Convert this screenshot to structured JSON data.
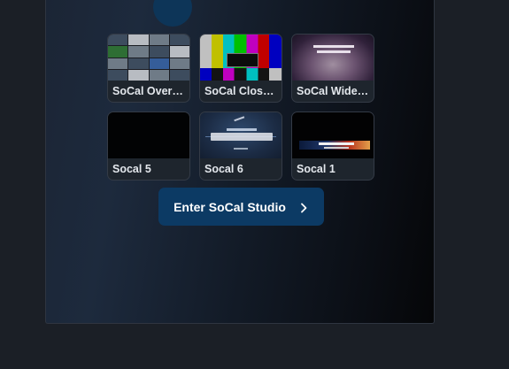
{
  "studios": [
    {
      "label": "SoCal Overh...",
      "thumb": "multi-camera-grid"
    },
    {
      "label": "SoCal Close ...",
      "thumb": "color-bars"
    },
    {
      "label": "SoCal Wide ...",
      "thumb": "wide-stage"
    },
    {
      "label": "Socal 5",
      "thumb": "no-signal-black"
    },
    {
      "label": "Socal 6",
      "thumb": "be-right-back"
    },
    {
      "label": "Socal 1",
      "thumb": "lower-third-graphic"
    }
  ],
  "enter_button": {
    "label": "Enter SoCal Studio",
    "icon": "chevron-right-icon"
  },
  "colors": {
    "accent": "#0c3a64",
    "page_bg": "#1b1f26",
    "card_bg": "#1e252d"
  }
}
